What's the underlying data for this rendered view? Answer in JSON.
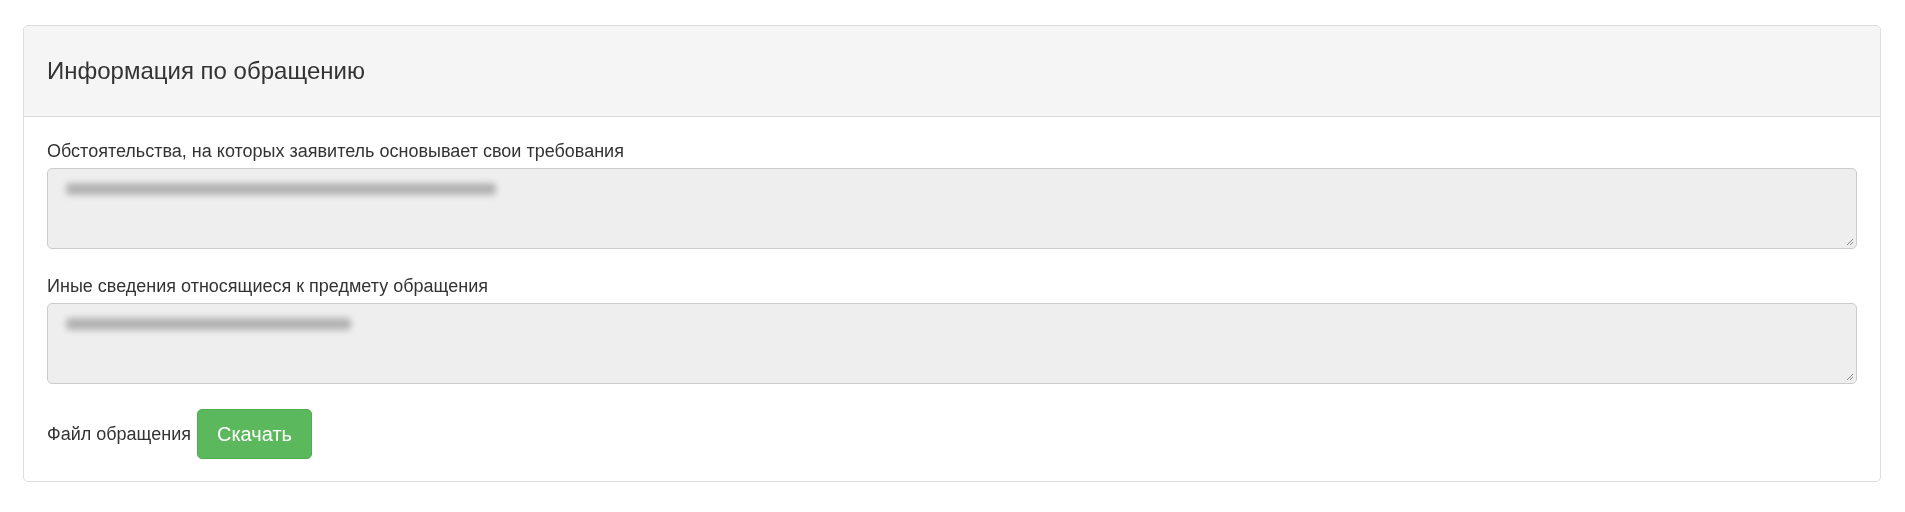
{
  "panel": {
    "title": "Информация по обращению",
    "fields": [
      {
        "label": "Обстоятельства, на которых заявитель основывает свои требования",
        "disabled": true
      },
      {
        "label": "Иные сведения относящиеся к предмету обращения",
        "disabled": true
      }
    ],
    "file": {
      "label": "Файл обращения",
      "button": "Скачать"
    }
  }
}
